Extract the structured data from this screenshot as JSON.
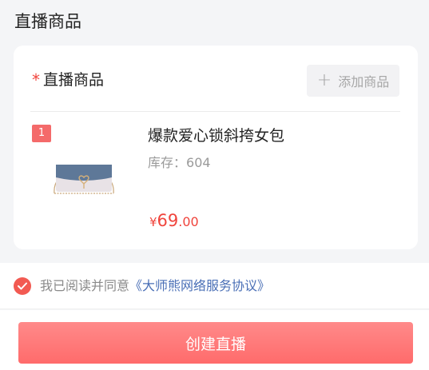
{
  "page": {
    "section_title": "直播商品"
  },
  "card": {
    "required_mark": "*",
    "label": "直播商品",
    "add_button_icon": "plus-icon",
    "add_button_label": "添加商品"
  },
  "product": {
    "rank": "1",
    "name": "爆款爱心锁斜挎女包",
    "stock_label": "库存：",
    "stock_value": "604",
    "price_currency": "¥",
    "price_integer": "69",
    "price_decimal": ".00",
    "thumbnail": "handbag-image"
  },
  "agreement": {
    "checked": true,
    "prefix": "我已阅读并同意",
    "link": "《大师熊网络服务协议》"
  },
  "footer": {
    "create_button_label": "创建直播"
  },
  "colors": {
    "accent_red": "#f0443c",
    "button_red": "#ff6b6b",
    "link_blue": "#4a6fb6"
  }
}
